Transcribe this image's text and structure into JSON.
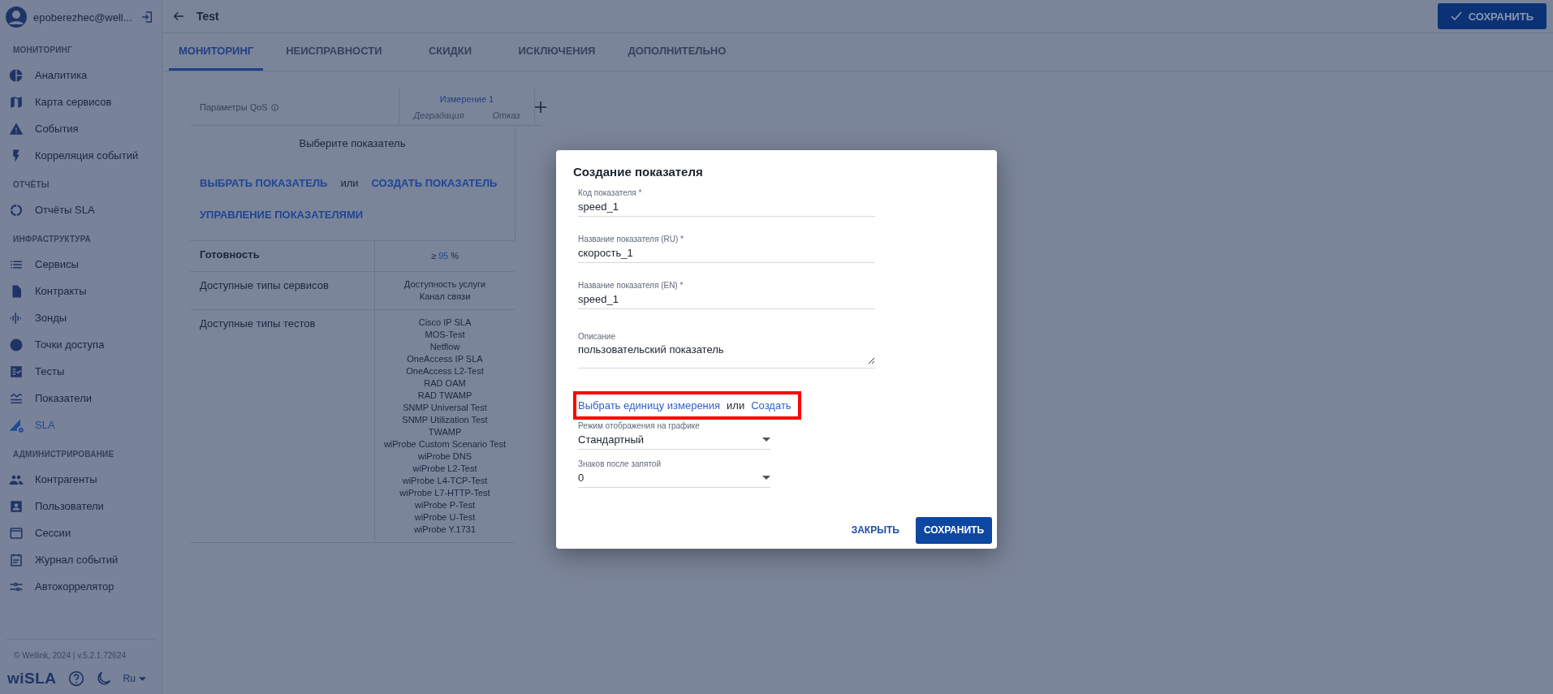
{
  "sidebar": {
    "user": "epoberezhec@well...",
    "sections": [
      {
        "title": "МОНИТОРИНГ",
        "items": [
          {
            "label": "Аналитика",
            "selected": false
          },
          {
            "label": "Карта сервисов",
            "selected": false
          },
          {
            "label": "События",
            "selected": false
          },
          {
            "label": "Корреляция событий",
            "selected": false
          }
        ]
      },
      {
        "title": "ОТЧЁТЫ",
        "items": [
          {
            "label": "Отчёты SLA",
            "selected": false
          }
        ]
      },
      {
        "title": "ИНФРАСТРУКТУРА",
        "items": [
          {
            "label": "Сервисы",
            "selected": false
          },
          {
            "label": "Контракты",
            "selected": false
          },
          {
            "label": "Зонды",
            "selected": false
          },
          {
            "label": "Точки доступа",
            "selected": false
          },
          {
            "label": "Тесты",
            "selected": false
          },
          {
            "label": "Показатели",
            "selected": false
          },
          {
            "label": "SLA",
            "selected": true
          }
        ]
      },
      {
        "title": "АДМИНИСТРИРОВАНИЕ",
        "items": [
          {
            "label": "Контрагенты",
            "selected": false
          },
          {
            "label": "Пользователи",
            "selected": false
          },
          {
            "label": "Сессии",
            "selected": false
          },
          {
            "label": "Журнал событий",
            "selected": false
          },
          {
            "label": "Автокоррелятор",
            "selected": false
          }
        ]
      }
    ],
    "footer": "© Wellink, 2024 | v.5.2.1.72624",
    "logo": "wiSLA",
    "language": "Ru"
  },
  "header": {
    "title": "Test",
    "save_button": "СОХРАНИТЬ"
  },
  "tabs": [
    {
      "label": "МОНИТОРИНГ",
      "selected": true
    },
    {
      "label": "НЕИСПРАВНОСТИ",
      "selected": false
    },
    {
      "label": "СКИДКИ",
      "selected": false
    },
    {
      "label": "ИСКЛЮЧЕНИЯ",
      "selected": false
    },
    {
      "label": "ДОПОЛНИТЕЛЬНО",
      "selected": false
    }
  ],
  "qos_table": {
    "parameter_header": "Параметры QoS",
    "measurement": "Измерение 1",
    "sub_columns": [
      "Деградация",
      "Отказ"
    ],
    "empty_text": "Выберите показатель",
    "select_link": "ВЫБРАТЬ ПОКАЗАТЕЛЬ",
    "or_text": "или",
    "create_link": "СОЗДАТЬ ПОКАЗАТЕЛЬ",
    "manage_link": "УПРАВЛЕНИЕ ПОКАЗАТЕЛЯМИ",
    "rows": [
      {
        "kind": "threshold",
        "label": "Готовность",
        "prefix": "≥",
        "value": "95",
        "unit": "%"
      },
      {
        "kind": "list",
        "label": "Доступные типы сервисов",
        "values": [
          "Доступность услуги",
          "Канал связи"
        ]
      },
      {
        "kind": "list",
        "label": "Доступные типы тестов",
        "values": [
          "Cisco IP SLA",
          "MOS-Test",
          "Netflow",
          "OneAccess IP SLA",
          "OneAccess L2-Test",
          "RAD OAM",
          "RAD TWAMP",
          "SNMP Universal Test",
          "SNMP Utilization Test",
          "TWAMP",
          "wiProbe Custom Scenario Test",
          "wiProbe DNS",
          "wiProbe L2-Test",
          "wiProbe L4-TCP-Test",
          "wiProbe L7-HTTP-Test",
          "wiProbe P-Test",
          "wiProbe U-Test",
          "wiProbe Y.1731"
        ]
      }
    ]
  },
  "dialog": {
    "title": "Создание показателя",
    "items": [
      {
        "kind": "text",
        "label": "Код показателя *",
        "value": "speed_1"
      },
      {
        "kind": "text",
        "label": "Название показателя (RU) *",
        "value": "скорость_1"
      },
      {
        "kind": "text",
        "label": "Название показателя (EN) *",
        "value": "speed_1"
      },
      {
        "kind": "textarea",
        "label": "Описание",
        "value": "пользовательский показатель"
      },
      {
        "kind": "unit_links",
        "select": "Выбрать единицу измерения",
        "or": "или",
        "create": "Создать",
        "highlighted": true
      },
      {
        "kind": "select",
        "label": "Режим отображения на графике",
        "value": "Стандартный"
      },
      {
        "kind": "select",
        "label": "Знаков после запятой",
        "value": "0"
      }
    ],
    "close_button": "ЗАКРЫТЬ",
    "save_button": "СОХРАНИТЬ"
  }
}
